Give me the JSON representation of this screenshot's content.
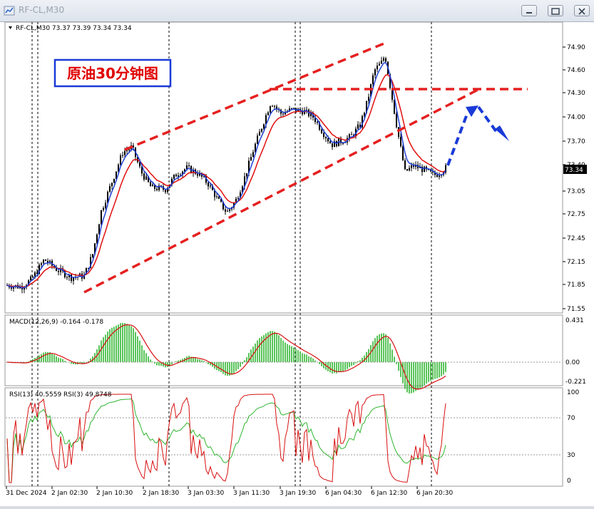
{
  "window": {
    "title": "RF-CL,M30",
    "controls": [
      "minimize-button",
      "restore-button",
      "close-button"
    ]
  },
  "main_chart": {
    "info_label": "RF-CL,M30  73.37 73.39 73.34 73.34",
    "annotation_title": "原油30分钟图",
    "price_axis": [
      "74.90",
      "74.60",
      "74.30",
      "74.00",
      "73.70",
      "73.40",
      "73.05",
      "72.75",
      "72.45",
      "72.15",
      "71.85",
      "71.55"
    ],
    "current_price_tag": "73.34",
    "colors": {
      "ma_fast": "#1f3fd6",
      "ma_slow": "#e01010",
      "candles": "#000000",
      "trend_lines": "#e52020",
      "forecast_arrow": "#1a3ad8",
      "annotation_border": "#1a3ad8",
      "annotation_text": "#e00000"
    }
  },
  "macd_panel": {
    "label": "MACD(12,26,9) -0.164 -0.178",
    "axis": [
      "0.431",
      "0.00",
      "-0.221"
    ],
    "colors": {
      "histogram": "#2fb52f",
      "signal": "#d81010"
    }
  },
  "rsi_panel": {
    "label": "RSI(13) 40.5559  RSI(3) 49.8748",
    "axis": [
      "100",
      "70",
      "30",
      "0"
    ],
    "colors": {
      "rsi13": "#2fb52f",
      "rsi3": "#d81010"
    }
  },
  "time_axis": [
    "31 Dec 2024",
    "2 Jan 02:30",
    "2 Jan 10:30",
    "2 Jan 18:30",
    "3 Jan 03:30",
    "3 Jan 11:30",
    "3 Jan 19:30",
    "6 Jan 04:30",
    "6 Jan 12:30",
    "6 Jan 20:30"
  ]
}
